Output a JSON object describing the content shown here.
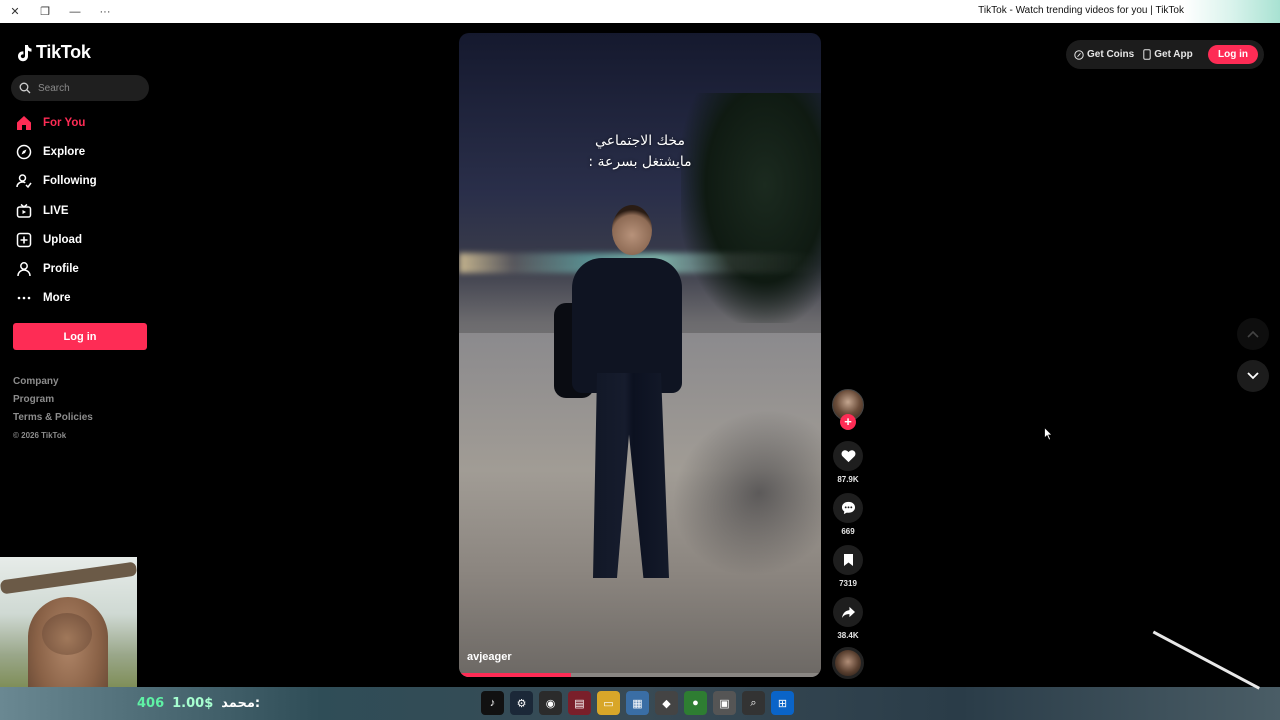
{
  "window": {
    "title": "TikTok - Watch trending videos for you | TikTok"
  },
  "sidebar": {
    "logo": "TikTok",
    "search_placeholder": "Search",
    "nav": [
      {
        "label": "For You",
        "icon": "home-icon",
        "active": true
      },
      {
        "label": "Explore",
        "icon": "compass-icon",
        "active": false
      },
      {
        "label": "Following",
        "icon": "following-icon",
        "active": false
      },
      {
        "label": "LIVE",
        "icon": "live-icon",
        "active": false
      },
      {
        "label": "Upload",
        "icon": "upload-icon",
        "active": false
      },
      {
        "label": "Profile",
        "icon": "profile-icon",
        "active": false
      },
      {
        "label": "More",
        "icon": "more-icon",
        "active": false
      }
    ],
    "login_label": "Log in",
    "footer": {
      "links": [
        "Company",
        "Program",
        "Terms & Policies"
      ],
      "copyright": "© 2026 TikTok"
    }
  },
  "video": {
    "caption_line1": "مخك الاجتماعي",
    "caption_line2": "مايشتغل بسرعة :",
    "author": "avjeager",
    "progress": 0.31
  },
  "actions": {
    "likes": "87.9K",
    "comments": "669",
    "saves": "7319",
    "shares": "38.4K"
  },
  "header": {
    "get_coins": "Get Coins",
    "get_app": "Get App",
    "login": "Log in"
  },
  "overlay": {
    "ticker_left": "406",
    "ticker_price": "1.00$",
    "ticker_name": "محمد:"
  },
  "colors": {
    "brand": "#fe2c55",
    "background": "#000000"
  }
}
